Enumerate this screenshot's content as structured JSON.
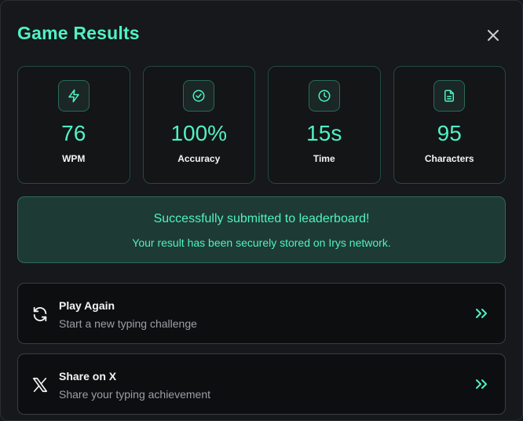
{
  "header": {
    "title": "Game Results"
  },
  "colors": {
    "accent": "#4ff2c4",
    "background": "#16181b",
    "success_bg": "#1e3a34"
  },
  "stats": [
    {
      "icon": "lightning-icon",
      "value": "76",
      "label": "WPM"
    },
    {
      "icon": "check-circle-icon",
      "value": "100%",
      "label": "Accuracy"
    },
    {
      "icon": "clock-icon",
      "value": "15s",
      "label": "Time"
    },
    {
      "icon": "document-icon",
      "value": "95",
      "label": "Characters"
    }
  ],
  "success": {
    "title": "Successfully submitted to leaderboard!",
    "subtitle": "Your result has been securely stored on Irys network."
  },
  "actions": {
    "play_again": {
      "title": "Play Again",
      "subtitle": "Start a new typing challenge",
      "icon": "refresh-icon"
    },
    "share": {
      "title": "Share on X",
      "subtitle": "Share your typing achievement",
      "icon": "x-logo-icon"
    }
  }
}
